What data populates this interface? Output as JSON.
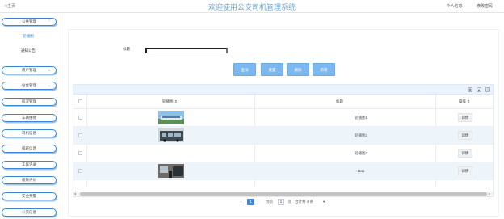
{
  "header": {
    "home": "□主页",
    "title": "欢迎使用公交司机管理系统",
    "profile": "个人信息",
    "change_password": "修改密码"
  },
  "sidebar": {
    "items": [
      {
        "label": "公共管理",
        "expanded": true
      },
      {
        "label": "轮播图",
        "active": true
      },
      {
        "label": "通知公告"
      },
      {
        "label": "用户管理"
      },
      {
        "label": "站台管理"
      },
      {
        "label": "班次管理"
      },
      {
        "label": "车辆维修"
      },
      {
        "label": "司机信息"
      },
      {
        "label": "排班信息"
      },
      {
        "label": "工作记录"
      },
      {
        "label": "绩效评价"
      },
      {
        "label": "安全预警"
      },
      {
        "label": "公交信息"
      }
    ]
  },
  "search": {
    "label": "标题",
    "placeholder": ""
  },
  "toolbar": {
    "query": "查询",
    "reset": "重置",
    "delete": "删除",
    "add": "新增"
  },
  "table": {
    "columns": [
      "轮播图 ⇕",
      "标题",
      "操作 ⇕"
    ],
    "rows": [
      {
        "title": "轮播图1",
        "action": "详情",
        "image": "bus-station-photo"
      },
      {
        "title": "轮播图2",
        "action": "详情",
        "image": "bus-photo"
      },
      {
        "title": "轮播图3",
        "action": "详情",
        "image": ""
      },
      {
        "title": "1111",
        "action": "详情",
        "image": "bus-interior-photo"
      }
    ]
  },
  "pagination": {
    "prev": "‹",
    "current": "1",
    "next": "›",
    "goto": "到第",
    "page_input": "1",
    "page_unit": "页",
    "total": "合计共 4 条",
    "per_page": "▾"
  },
  "colors": {
    "accent": "#3d86d4",
    "button": "#7cb8f0",
    "title": "#6aa4d8",
    "row_alt": "#edf5fb"
  }
}
